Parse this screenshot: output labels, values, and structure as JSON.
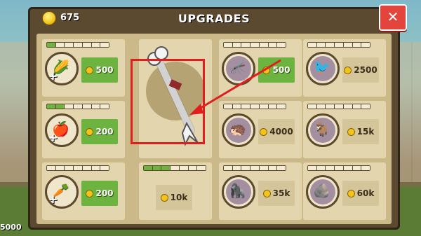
{
  "header": {
    "coins": "675",
    "title": "UPGRADES",
    "close_icon": "close-icon"
  },
  "background": {
    "coins_bottom_left": "5000"
  },
  "upgrades": [
    {
      "name": "corn",
      "icon": "🌽",
      "price": "500",
      "style": "green",
      "level": 1,
      "plus": true
    },
    {
      "name": "bone",
      "icon": "bone-icon",
      "price": "",
      "style": "",
      "level": 0,
      "plus": false
    },
    {
      "name": "mosquito",
      "icon": "🦟",
      "price": "500",
      "style": "green",
      "level": 0,
      "plus": false
    },
    {
      "name": "woodpecker",
      "icon": "🐦",
      "price": "2500",
      "style": "tan",
      "level": 0,
      "plus": false
    },
    {
      "name": "apple",
      "icon": "🍎",
      "price": "200",
      "style": "green",
      "level": 2,
      "plus": true
    },
    {
      "name": "hedgehog",
      "icon": "🦔",
      "price": "4000",
      "style": "tan",
      "level": 0,
      "plus": false
    },
    {
      "name": "goat",
      "icon": "🐐",
      "price": "15k",
      "style": "tan",
      "level": 0,
      "plus": false
    },
    {
      "name": "carrot",
      "icon": "🥕",
      "price": "200",
      "style": "green",
      "level": 0,
      "plus": true
    },
    {
      "name": "bone-upgrade",
      "icon": "",
      "price": "10k",
      "style": "tan",
      "level": 3,
      "plus": false
    },
    {
      "name": "gorilla",
      "icon": "🦍",
      "price": "35k",
      "style": "tan",
      "level": 0,
      "plus": false
    },
    {
      "name": "rock",
      "icon": "🪨",
      "price": "60k",
      "style": "tan",
      "level": 0,
      "plus": false
    }
  ],
  "colors": {
    "accent_red": "#e11e1e",
    "green_btn": "#6db33f"
  }
}
